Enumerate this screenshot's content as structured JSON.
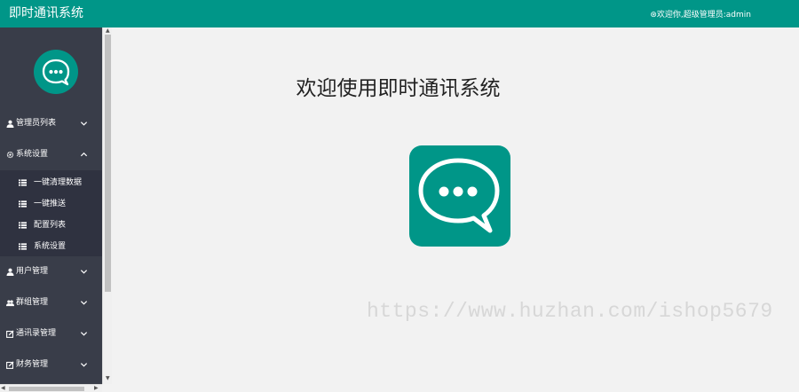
{
  "header": {
    "app_title": "即时通讯系统",
    "welcome_text": "⊛欢迎你,超级管理员:admin",
    "bg_color": "#009688"
  },
  "sidebar": {
    "bg_color": "#393d49",
    "menu": [
      {
        "label": "管理员列表",
        "icon": "user-icon",
        "expanded": false
      },
      {
        "label": "系统设置",
        "icon": "gear-icon",
        "expanded": true
      },
      {
        "label": "用户管理",
        "icon": "user-icon",
        "expanded": false
      },
      {
        "label": "群组管理",
        "icon": "group-icon",
        "expanded": false
      },
      {
        "label": "通讯录管理",
        "icon": "edit-icon",
        "expanded": false
      },
      {
        "label": "财务管理",
        "icon": "edit-icon",
        "expanded": false
      }
    ],
    "submenu": [
      {
        "label": "一键清理数据",
        "icon": "list-icon"
      },
      {
        "label": "一键推送",
        "icon": "list-icon"
      },
      {
        "label": "配置列表",
        "icon": "list-icon"
      },
      {
        "label": "系统设置",
        "icon": "list-icon"
      }
    ]
  },
  "main": {
    "title": "欢迎使用即时通讯系统",
    "logo_icon": "chat-bubble-icon",
    "accent_color": "#009688"
  },
  "watermark": {
    "text": "https://www.huzhan.com/ishop5679"
  }
}
